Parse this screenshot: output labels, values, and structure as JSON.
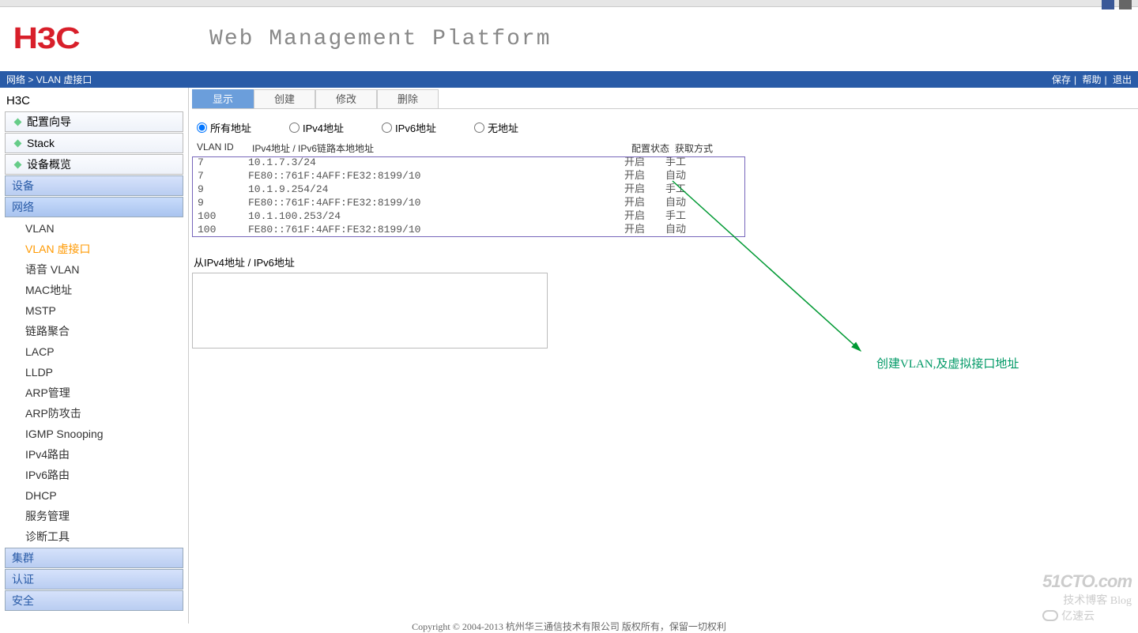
{
  "header": {
    "logo_text": "H3C",
    "platform_title": "Web Management Platform"
  },
  "breadcrumb": {
    "part1": "网络",
    "sep": " > ",
    "part2": "VLAN 虚接口",
    "save": "保存",
    "help": "帮助",
    "logout": "退出"
  },
  "sidebar": {
    "device_root": "H3C",
    "top_items": [
      "配置向导",
      "Stack",
      "设备概览"
    ],
    "sections_before": [
      "设备"
    ],
    "active_section": "网络",
    "network_children": [
      "VLAN",
      "VLAN 虚接口",
      "语音 VLAN",
      "MAC地址",
      "MSTP",
      "链路聚合",
      "LACP",
      "LLDP",
      "ARP管理",
      "ARP防攻击",
      "IGMP Snooping",
      "IPv4路由",
      "IPv6路由",
      "DHCP",
      "服务管理",
      "诊断工具"
    ],
    "active_child": "VLAN 虚接口",
    "sections_after": [
      "集群",
      "认证",
      "安全"
    ]
  },
  "tabs": [
    "显示",
    "创建",
    "修改",
    "删除"
  ],
  "active_tab": "显示",
  "radios": [
    "所有地址",
    "IPv4地址",
    "IPv6地址",
    "无地址"
  ],
  "selected_radio": "所有地址",
  "table": {
    "headers": {
      "c1": "VLAN ID",
      "c2": "IPv4地址 / IPv6链路本地地址",
      "c3": "配置状态",
      "c4": "获取方式"
    },
    "rows": [
      {
        "vlan": "7",
        "addr": "10.1.7.3/24",
        "state": "开启",
        "mode": "手工"
      },
      {
        "vlan": "7",
        "addr": "FE80::761F:4AFF:FE32:8199/10",
        "state": "开启",
        "mode": "自动"
      },
      {
        "vlan": "9",
        "addr": "10.1.9.254/24",
        "state": "开启",
        "mode": "手工"
      },
      {
        "vlan": "9",
        "addr": "FE80::761F:4AFF:FE32:8199/10",
        "state": "开启",
        "mode": "自动"
      },
      {
        "vlan": "100",
        "addr": "10.1.100.253/24",
        "state": "开启",
        "mode": "手工"
      },
      {
        "vlan": "100",
        "addr": "FE80::761F:4AFF:FE32:8199/10",
        "state": "开启",
        "mode": "自动"
      }
    ]
  },
  "sub_label": "从IPv4地址 / IPv6地址",
  "annotation": "创建VLAN,及虚拟接口地址",
  "footer": "Copyright © 2004-2013 杭州华三通信技术有限公司 版权所有，保留一切权利",
  "watermark": {
    "line1": "51CTO.com",
    "line2": "技术博客  Blog",
    "yisu": "亿速云"
  }
}
